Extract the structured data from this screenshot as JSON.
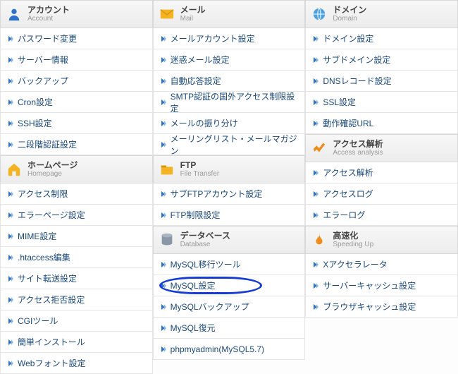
{
  "sections": {
    "account": {
      "title_ja": "アカウント",
      "title_en": "Account",
      "items": [
        "パスワード変更",
        "サーバー情報",
        "バックアップ",
        "Cron設定",
        "SSH設定",
        "二段階認証設定"
      ]
    },
    "mail": {
      "title_ja": "メール",
      "title_en": "Mail",
      "items": [
        "メールアカウント設定",
        "迷惑メール設定",
        "自動応答設定",
        "SMTP認証の国外アクセス制限設定",
        "メールの振り分け",
        "メーリングリスト・メールマガジン"
      ]
    },
    "domain": {
      "title_ja": "ドメイン",
      "title_en": "Domain",
      "items": [
        "ドメイン設定",
        "サブドメイン設定",
        "DNSレコード設定",
        "SSL設定",
        "動作確認URL"
      ]
    },
    "homepage": {
      "title_ja": "ホームページ",
      "title_en": "Homepage",
      "items": [
        "アクセス制限",
        "エラーページ設定",
        "MIME設定",
        ".htaccess編集",
        "サイト転送設定",
        "アクセス拒否設定",
        "CGIツール",
        "簡単インストール",
        "Webフォント設定"
      ]
    },
    "ftp": {
      "title_ja": "FTP",
      "title_en": "File Transfer",
      "items": [
        "サブFTPアカウント設定",
        "FTP制限設定"
      ]
    },
    "access": {
      "title_ja": "アクセス解析",
      "title_en": "Access analysis",
      "items": [
        "アクセス解析",
        "アクセスログ",
        "エラーログ"
      ]
    },
    "database": {
      "title_ja": "データベース",
      "title_en": "Database",
      "items": [
        "MySQL移行ツール",
        "MySQL設定",
        "MySQLバックアップ",
        "MySQL復元",
        "phpmyadmin(MySQL5.7)"
      ]
    },
    "speed": {
      "title_ja": "高速化",
      "title_en": "Speeding Up",
      "items": [
        "Xアクセラレータ",
        "サーバーキャッシュ設定",
        "ブラウザキャッシュ設定"
      ]
    }
  },
  "highlighted_item": "MySQL設定"
}
